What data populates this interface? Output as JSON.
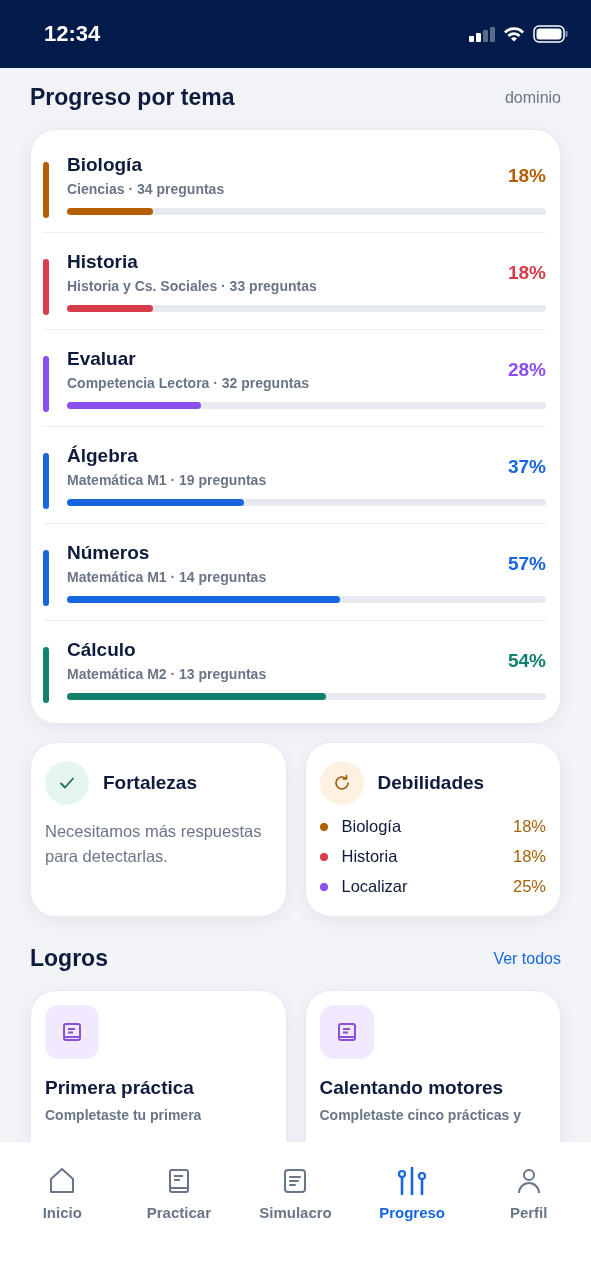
{
  "status_bar": {
    "time": "12:34"
  },
  "progress": {
    "title": "Progreso por tema",
    "caption": "dominio",
    "topics": [
      {
        "name": "Biología",
        "subtitle": "Ciencias · 34 preguntas",
        "percent": "18%",
        "level": 0.18,
        "color": "#b45f06"
      },
      {
        "name": "Historia",
        "subtitle": "Historia y Cs. Sociales · 33 preguntas",
        "percent": "18%",
        "level": 0.18,
        "color": "#d63c4a"
      },
      {
        "name": "Evaluar",
        "subtitle": "Competencia Lectora · 32 preguntas",
        "percent": "28%",
        "level": 0.28,
        "color": "#8b4ff0"
      },
      {
        "name": "Álgebra",
        "subtitle": "Matemática M1 · 19 preguntas",
        "percent": "37%",
        "level": 0.37,
        "color": "#1766e0"
      },
      {
        "name": "Números",
        "subtitle": "Matemática M1 · 14 preguntas",
        "percent": "57%",
        "level": 0.57,
        "color": "#1766e0"
      },
      {
        "name": "Cálculo",
        "subtitle": "Matemática M2 · 13 preguntas",
        "percent": "54%",
        "level": 0.54,
        "color": "#12806e"
      }
    ]
  },
  "strengths": {
    "title": "Fortalezas",
    "message": "Necesitamos más respuestas para detectarlas."
  },
  "weaknesses": {
    "title": "Debilidades",
    "items": [
      {
        "name": "Biología",
        "percent": "18%",
        "color": "#b45f06"
      },
      {
        "name": "Historia",
        "percent": "18%",
        "color": "#d63c4a"
      },
      {
        "name": "Localizar",
        "percent": "25%",
        "color": "#8b4ff0"
      }
    ]
  },
  "achievements": {
    "title": "Logros",
    "link": "Ver todos",
    "items": [
      {
        "title": "Primera práctica",
        "description": "Completaste tu primera"
      },
      {
        "title": "Calentando motores",
        "description": "Completaste cinco prácticas y"
      }
    ]
  },
  "nav": [
    {
      "label": "Inicio",
      "kind": "home",
      "selected": false
    },
    {
      "label": "Practicar",
      "kind": "book",
      "selected": false
    },
    {
      "label": "Simulacro",
      "kind": "document",
      "selected": false
    },
    {
      "label": "Progreso",
      "kind": "sliders",
      "selected": true
    },
    {
      "label": "Perfil",
      "kind": "person",
      "selected": false
    }
  ]
}
